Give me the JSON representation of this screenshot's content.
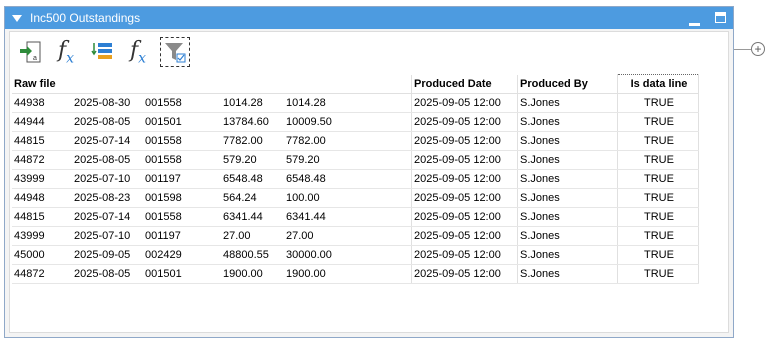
{
  "window": {
    "title": "Inc500 Outstandings"
  },
  "toolbar": {
    "buttons": [
      {
        "name": "import-data-button",
        "icon": "import-icon"
      },
      {
        "name": "formula-button",
        "icon": "fx-icon",
        "glyph": "f",
        "sub": "x"
      },
      {
        "name": "list-button",
        "icon": "list-icon"
      },
      {
        "name": "formula-2-button",
        "icon": "fx-icon",
        "glyph": "f",
        "sub": "x"
      },
      {
        "name": "filter-button",
        "icon": "filter-icon"
      }
    ]
  },
  "table": {
    "headers": [
      "Raw file",
      "",
      "",
      "",
      "",
      "Produced Date",
      "Produced By",
      "Is data line"
    ],
    "rows": [
      [
        "44938",
        "2025-08-30",
        "001558",
        "1014.28",
        "1014.28",
        "2025-09-05 12:00",
        "S.Jones",
        "TRUE"
      ],
      [
        "44944",
        "2025-08-05",
        "001501",
        "13784.60",
        "10009.50",
        "2025-09-05 12:00",
        "S.Jones",
        "TRUE"
      ],
      [
        "44815",
        "2025-07-14",
        "001558",
        "7782.00",
        "7782.00",
        "2025-09-05 12:00",
        "S.Jones",
        "TRUE"
      ],
      [
        "44872",
        "2025-08-05",
        "001558",
        "579.20",
        "579.20",
        "2025-09-05 12:00",
        "S.Jones",
        "TRUE"
      ],
      [
        "43999",
        "2025-07-10",
        "001197",
        "6548.48",
        "6548.48",
        "2025-09-05 12:00",
        "S.Jones",
        "TRUE"
      ],
      [
        "44948",
        "2025-08-23",
        "001598",
        "564.24",
        "100.00",
        "2025-09-05 12:00",
        "S.Jones",
        "TRUE"
      ],
      [
        "44815",
        "2025-07-14",
        "001558",
        "6341.44",
        "6341.44",
        "2025-09-05 12:00",
        "S.Jones",
        "TRUE"
      ],
      [
        "43999",
        "2025-07-10",
        "001197",
        "27.00",
        "27.00",
        "2025-09-05 12:00",
        "S.Jones",
        "TRUE"
      ],
      [
        "45000",
        "2025-09-05",
        "002429",
        "48800.55",
        "30000.00",
        "2025-09-05 12:00",
        "S.Jones",
        "TRUE"
      ],
      [
        "44872",
        "2025-08-05",
        "001501",
        "1900.00",
        "1900.00",
        "2025-09-05 12:00",
        "S.Jones",
        "TRUE"
      ]
    ]
  },
  "side": {
    "plus": "+"
  }
}
